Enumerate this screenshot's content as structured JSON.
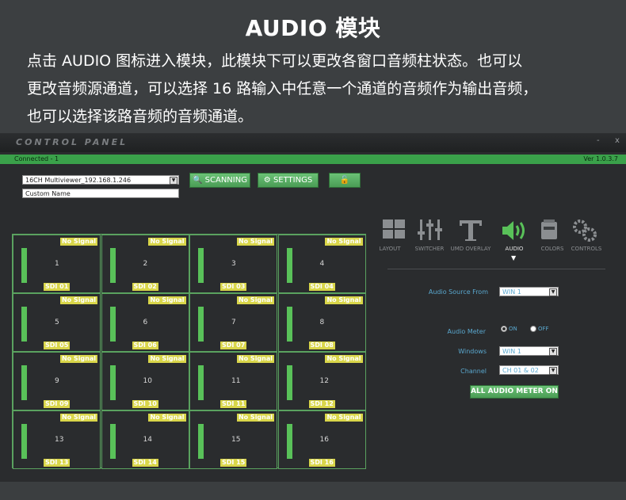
{
  "intro": {
    "title": "AUDIO 模块",
    "lines": [
      "点击 AUDIO 图标进入模块，此模块下可以更改各窗口音频柱状态。也可以",
      "更改音频源通道，可以选择 16 路输入中任意一个通道的音频作为输出音频，",
      "也可以选择该路音频的音频通道。"
    ]
  },
  "app": {
    "brand": "CONTROL PANEL",
    "minimize": "-",
    "close": "x",
    "status": "Connected - 1",
    "version": "Ver 1.0.3.7",
    "device_select": "16CH Multiviewer_192.168.1.246",
    "custom_name": "Custom Name",
    "scan_label": "SCANNING",
    "settings_label": "SETTINGS"
  },
  "cells": [
    {
      "num": "1",
      "sdi": "SDI 01",
      "status": "No Signal"
    },
    {
      "num": "2",
      "sdi": "SDI 02",
      "status": "No Signal"
    },
    {
      "num": "3",
      "sdi": "SDI 03",
      "status": "No Signal"
    },
    {
      "num": "4",
      "sdi": "SDI 04",
      "status": "No Signal"
    },
    {
      "num": "5",
      "sdi": "SDI 05",
      "status": "No Signal"
    },
    {
      "num": "6",
      "sdi": "SDI 06",
      "status": "No Signal"
    },
    {
      "num": "7",
      "sdi": "SDI 07",
      "status": "No Signal"
    },
    {
      "num": "8",
      "sdi": "SDI 08",
      "status": "No Signal"
    },
    {
      "num": "9",
      "sdi": "SDI 09",
      "status": "No Signal"
    },
    {
      "num": "10",
      "sdi": "SDI 10",
      "status": "No Signal"
    },
    {
      "num": "11",
      "sdi": "SDI 11",
      "status": "No Signal"
    },
    {
      "num": "12",
      "sdi": "SDI 12",
      "status": "No Signal"
    },
    {
      "num": "13",
      "sdi": "SDI 13",
      "status": "No Signal"
    },
    {
      "num": "14",
      "sdi": "SDI 14",
      "status": "No Signal"
    },
    {
      "num": "15",
      "sdi": "SDI 15",
      "status": "No Signal"
    },
    {
      "num": "16",
      "sdi": "SDI 16",
      "status": "No Signal"
    }
  ],
  "nav": [
    {
      "label": "LAYOUT",
      "icon": "layout-icon"
    },
    {
      "label": "SWITCHER",
      "icon": "switcher-icon"
    },
    {
      "label": "UMD OVERLAY",
      "icon": "umd-overlay-icon"
    },
    {
      "label": "AUDIO",
      "icon": "audio-icon",
      "active": true
    },
    {
      "label": "COLORS",
      "icon": "colors-icon"
    },
    {
      "label": "CONTROLS",
      "icon": "controls-icon"
    }
  ],
  "audio": {
    "source_label": "Audio Source From",
    "source_value": "WIN 1",
    "meter_label": "Audio Meter",
    "meter_on": "ON",
    "meter_off": "OFF",
    "windows_label": "Windows",
    "windows_value": "WIN 1",
    "channel_label": "Channel",
    "channel_value": "CH 01 & 02",
    "all_on_label": "ALL AUDIO METER ON"
  },
  "colors": {
    "accent_green": "#4a9c55",
    "yellow_badge": "#d9d64a",
    "label_blue": "#5aa8cf"
  }
}
